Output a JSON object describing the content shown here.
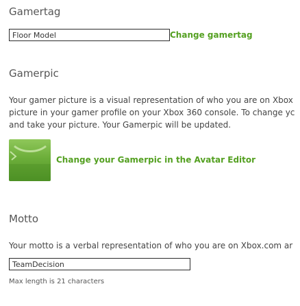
{
  "gamertag": {
    "title": "Gamertag",
    "input_value": "Floor Model",
    "change_link": "Change gamertag"
  },
  "gamerpic": {
    "title": "Gamerpic",
    "description_lines": [
      "Your gamer picture is a visual representation of who you are on Xbox",
      "picture in your gamer profile on your Xbox 360 console. To change yc",
      "and take your picture. Your Gamerpic will be updated."
    ],
    "change_link": "Change your Gamerpic in the Avatar Editor"
  },
  "motto": {
    "title": "Motto",
    "description": "Your motto is a verbal representation of who you are on Xbox.com ar",
    "input_value": "TeamDecision",
    "hint": "Max length is 21 characters"
  },
  "colors": {
    "link": "#54a021",
    "accent_green": "#6cae3a"
  }
}
